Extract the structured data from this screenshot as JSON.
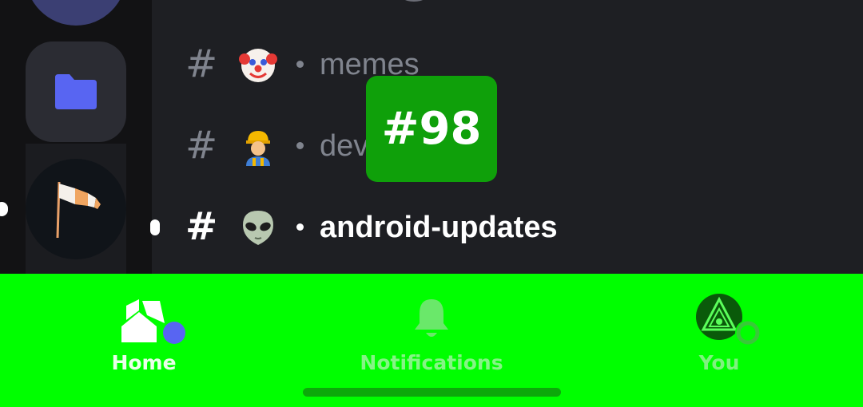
{
  "channels": [
    {
      "name": "memes",
      "emoji": "clown-face",
      "active": false
    },
    {
      "name": "development",
      "emoji": "construction-worker",
      "active": false
    },
    {
      "name": "android-updates",
      "emoji": "alien",
      "active": true
    }
  ],
  "hash_symbol": "#",
  "badge": {
    "text": "#98",
    "color": "#0fa00a"
  },
  "nav": {
    "home_label": "Home",
    "notifications_label": "Notifications",
    "you_label": "You"
  },
  "colors": {
    "accent": "#5865f2",
    "nav_bg": "#00ff00",
    "channel_muted": "#80848e"
  },
  "icons": [
    "folder-icon",
    "windsock-icon",
    "home-icon",
    "bell-icon",
    "avatar-icon"
  ]
}
